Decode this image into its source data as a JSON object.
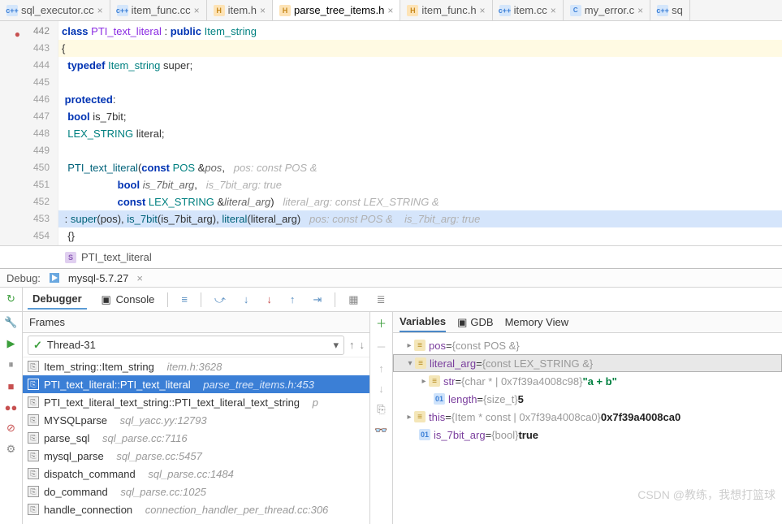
{
  "tabs": [
    {
      "icon": "cpp",
      "label": "sql_executor.cc"
    },
    {
      "icon": "cpp",
      "label": "item_func.cc"
    },
    {
      "icon": "h",
      "label": "item.h"
    },
    {
      "icon": "h",
      "label": "parse_tree_items.h",
      "active": true
    },
    {
      "icon": "h",
      "label": "item_func.h"
    },
    {
      "icon": "cpp",
      "label": "item.cc"
    },
    {
      "icon": "c",
      "label": "my_error.c"
    },
    {
      "icon": "cpp",
      "label": "sq"
    }
  ],
  "gutter": [
    "442",
    "443",
    "444",
    "445",
    "446",
    "447",
    "448",
    "449",
    "450",
    "451",
    "452",
    "453",
    "454"
  ],
  "code": {
    "l442": {
      "kw1": "class",
      "cls": "PTI_text_literal",
      "kw2": "public",
      "base": "Item_string"
    },
    "l443": "{",
    "l444": {
      "kw": "typedef",
      "type": "Item_string",
      "name": "super"
    },
    "l446": {
      "kw": "protected"
    },
    "l447": {
      "kw": "bool",
      "name": "is_7bit"
    },
    "l448": {
      "type": "LEX_STRING",
      "name": "literal"
    },
    "l450": {
      "ctor": "PTI_text_literal",
      "kw": "const",
      "type": "POS",
      "amp": "&",
      "p": "pos",
      "h": "pos: const POS &"
    },
    "l451": {
      "kw": "bool",
      "p": "is_7bit_arg",
      "h": "is_7bit_arg: true"
    },
    "l452": {
      "kw": "const",
      "type": "LEX_STRING",
      "amp": "&",
      "p": "literal_arg",
      "h": "literal_arg: const LEX_STRING &"
    },
    "l453": {
      "pre": ": ",
      "f1": "super",
      "a1": "pos",
      "f2": "is_7bit",
      "a2": "is_7bit_arg",
      "f3": "literal",
      "a3": "literal_arg",
      "h": "pos: const POS &    is_7bit_arg: true"
    },
    "l454": "{}"
  },
  "crumb": {
    "label": "PTI_text_literal"
  },
  "debug": {
    "label": "Debug:",
    "config": "mysql-5.7.27"
  },
  "tb": {
    "debugger": "Debugger",
    "console": "Console"
  },
  "frames": {
    "title": "Frames",
    "thread": "Thread-31",
    "items": [
      {
        "name": "Item_string::Item_string",
        "loc": "item.h:3628"
      },
      {
        "name": "PTI_text_literal::PTI_text_literal",
        "loc": "parse_tree_items.h:453",
        "sel": true
      },
      {
        "name": "PTI_text_literal_text_string::PTI_text_literal_text_string",
        "loc": "p"
      },
      {
        "name": "MYSQLparse",
        "loc": "sql_yacc.yy:12793"
      },
      {
        "name": "parse_sql",
        "loc": "sql_parse.cc:7116"
      },
      {
        "name": "mysql_parse",
        "loc": "sql_parse.cc:5457"
      },
      {
        "name": "dispatch_command",
        "loc": "sql_parse.cc:1484"
      },
      {
        "name": "do_command",
        "loc": "sql_parse.cc:1025"
      },
      {
        "name": "handle_connection",
        "loc": "connection_handler_per_thread.cc:306"
      }
    ]
  },
  "vars": {
    "tabs": {
      "variables": "Variables",
      "gdb": "GDB",
      "memory": "Memory View"
    },
    "rows": {
      "pos": {
        "name": "pos",
        "eq": " = ",
        "type": "{const POS &}"
      },
      "literal": {
        "name": "literal_arg",
        "eq": " = ",
        "type": "{const LEX_STRING &}"
      },
      "str": {
        "name": "str",
        "eq": " = ",
        "type": "{char * | 0x7f39a4008c98}",
        "val": " \"a + b\""
      },
      "length": {
        "name": "length",
        "eq": " = ",
        "type": "{size_t}",
        "val": " 5"
      },
      "this": {
        "name": "this",
        "eq": " = ",
        "type": "{Item * const | 0x7f39a4008ca0}",
        "val": " 0x7f39a4008ca0"
      },
      "is7": {
        "name": "is_7bit_arg",
        "eq": " = ",
        "type": "{bool}",
        "val": " true"
      }
    }
  },
  "watermark": "CSDN @教练，我想打篮球"
}
